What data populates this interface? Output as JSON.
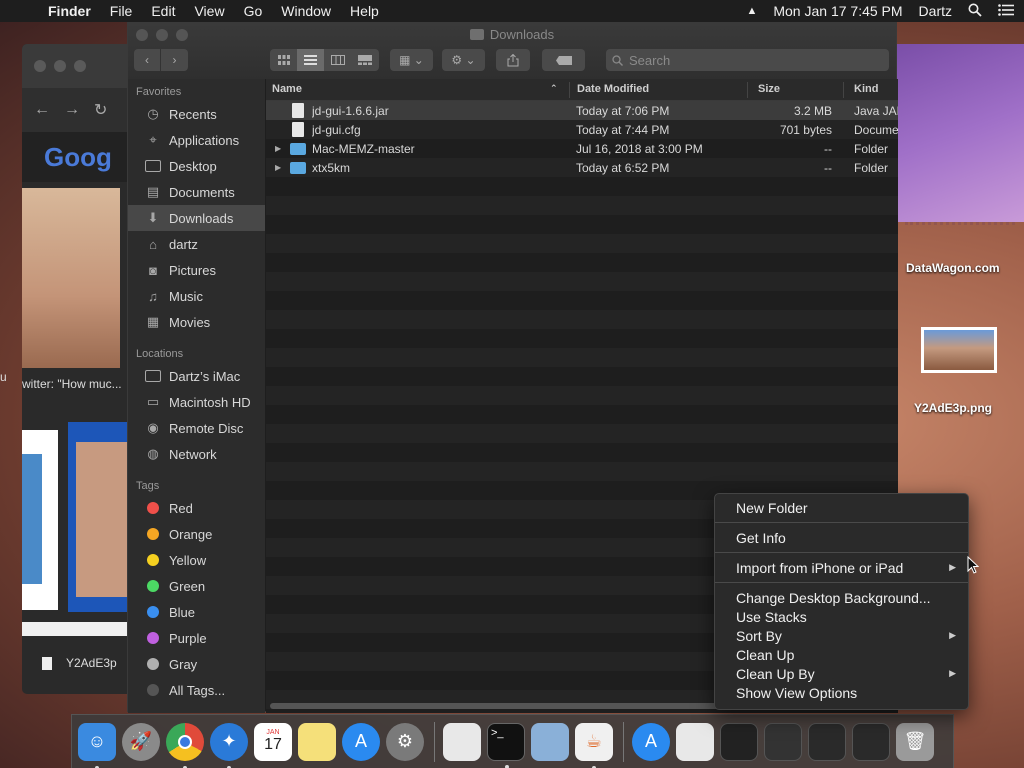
{
  "menubar": {
    "apple": "",
    "items": [
      "Finder",
      "File",
      "Edit",
      "View",
      "Go",
      "Window",
      "Help"
    ],
    "datetime": "Mon Jan 17  7:45 PM",
    "user": "Dartz"
  },
  "browser": {
    "logo_text": "Goog",
    "caption": "witter: \"How muc...",
    "leftcut": "u",
    "file_label": "Y2AdE3p"
  },
  "finder": {
    "title": "Downloads",
    "search_placeholder": "Search",
    "sidebar": {
      "favorites_heading": "Favorites",
      "favorites": [
        {
          "label": "Recents",
          "icon": "clock-icon"
        },
        {
          "label": "Applications",
          "icon": "applications-icon"
        },
        {
          "label": "Desktop",
          "icon": "desktop-icon"
        },
        {
          "label": "Documents",
          "icon": "documents-icon"
        },
        {
          "label": "Downloads",
          "icon": "download-icon"
        },
        {
          "label": "dartz",
          "icon": "home-icon"
        },
        {
          "label": "Pictures",
          "icon": "camera-icon"
        },
        {
          "label": "Music",
          "icon": "music-note-icon"
        },
        {
          "label": "Movies",
          "icon": "film-icon"
        }
      ],
      "locations_heading": "Locations",
      "locations": [
        {
          "label": "Dartz’s iMac",
          "icon": "monitor-icon"
        },
        {
          "label": "Macintosh HD",
          "icon": "hard-disk-icon"
        },
        {
          "label": "Remote Disc",
          "icon": "disc-icon"
        },
        {
          "label": "Network",
          "icon": "globe-icon"
        }
      ],
      "tags_heading": "Tags",
      "tags": [
        {
          "label": "Red",
          "color": "#f0504a"
        },
        {
          "label": "Orange",
          "color": "#f5a623"
        },
        {
          "label": "Yellow",
          "color": "#f5d020"
        },
        {
          "label": "Green",
          "color": "#4cd964"
        },
        {
          "label": "Blue",
          "color": "#3a8ff0"
        },
        {
          "label": "Purple",
          "color": "#c060e0"
        },
        {
          "label": "Gray",
          "color": "#b0b0b0"
        },
        {
          "label": "All Tags...",
          "color": "#555555"
        }
      ]
    },
    "columns": {
      "name": "Name",
      "date": "Date Modified",
      "size": "Size",
      "kind": "Kind"
    },
    "files": [
      {
        "name": "jd-gui-1.6.6.jar",
        "date": "Today at 7:06 PM",
        "size": "3.2 MB",
        "kind": "Java JAR",
        "type": "doc",
        "expandable": false
      },
      {
        "name": "jd-gui.cfg",
        "date": "Today at 7:44 PM",
        "size": "701 bytes",
        "kind": "Document",
        "type": "doc",
        "expandable": false
      },
      {
        "name": "Mac-MEMZ-master",
        "date": "Jul 16, 2018 at 3:00 PM",
        "size": "--",
        "kind": "Folder",
        "type": "folder",
        "expandable": true
      },
      {
        "name": "xtx5km",
        "date": "Today at 6:52 PM",
        "size": "--",
        "kind": "Folder",
        "type": "folder",
        "expandable": true
      }
    ]
  },
  "desktop": {
    "icon1_label": "DataWagon.com",
    "icon2_label": "Y2AdE3p.png"
  },
  "context_menu": {
    "groups": [
      [
        {
          "label": "New Folder",
          "submenu": false
        }
      ],
      [
        {
          "label": "Get Info",
          "submenu": false
        }
      ],
      [
        {
          "label": "Import from iPhone or iPad",
          "submenu": true
        }
      ],
      [
        {
          "label": "Change Desktop Background...",
          "submenu": false
        },
        {
          "label": "Use Stacks",
          "submenu": false
        },
        {
          "label": "Sort By",
          "submenu": true
        },
        {
          "label": "Clean Up",
          "submenu": false
        },
        {
          "label": "Clean Up By",
          "submenu": true
        },
        {
          "label": "Show View Options",
          "submenu": false
        }
      ]
    ]
  },
  "dock": {
    "calendar_month": "JAN",
    "calendar_day": "17",
    "apps": [
      {
        "name": "finder-icon",
        "color": "#3a8ae0",
        "running": true
      },
      {
        "name": "launchpad-icon",
        "color": "#8a8a8a",
        "running": false
      },
      {
        "name": "chrome-icon",
        "color": "#e04a3a",
        "running": true
      },
      {
        "name": "safari-icon",
        "color": "#2a7ad8",
        "running": true
      },
      {
        "name": "calendar-icon",
        "color": "#ffffff",
        "running": false
      },
      {
        "name": "notes-icon",
        "color": "#f5e07a",
        "running": false
      },
      {
        "name": "app-store-icon",
        "color": "#2a8af0",
        "running": false
      },
      {
        "name": "system-preferences-icon",
        "color": "#7a7a7a",
        "running": false
      }
    ],
    "apps2": [
      {
        "name": "text-edit-icon",
        "color": "#e8e8e8",
        "running": false
      },
      {
        "name": "terminal-icon",
        "color": "#111111",
        "running": true
      },
      {
        "name": "preview-icon",
        "color": "#8ab0d8",
        "running": false
      },
      {
        "name": "java-icon",
        "color": "#f0f0f0",
        "running": true
      }
    ],
    "apps3": [
      {
        "name": "app-store-download-icon",
        "color": "#2a8af0",
        "running": false
      },
      {
        "name": "document-stack-icon",
        "color": "#e8e8e8",
        "running": false
      },
      {
        "name": "minimized-window-icon",
        "color": "#222222",
        "running": false
      },
      {
        "name": "minimized-window-icon-2",
        "color": "#333333",
        "running": false
      },
      {
        "name": "minimized-window-icon-3",
        "color": "#2a2a2a",
        "running": false
      },
      {
        "name": "minimized-window-icon-4",
        "color": "#2a2a2a",
        "running": false
      },
      {
        "name": "trash-icon",
        "color": "#9a9a9a",
        "running": false
      }
    ]
  }
}
